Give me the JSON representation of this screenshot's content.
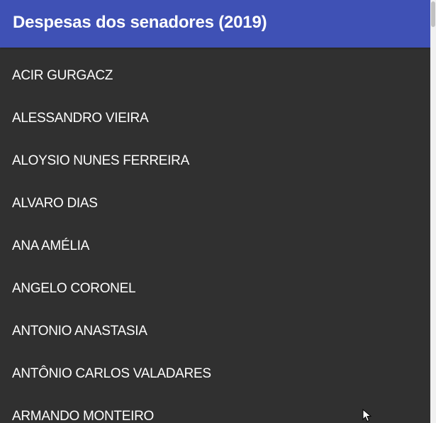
{
  "appbar": {
    "title": "Despesas dos senadores (2019)",
    "color": "#3f51b5"
  },
  "list": {
    "background": "#303030",
    "items": [
      {
        "label": "ACIR GURGACZ"
      },
      {
        "label": "ALESSANDRO VIEIRA"
      },
      {
        "label": "ALOYSIO NUNES FERREIRA"
      },
      {
        "label": "ALVARO DIAS"
      },
      {
        "label": "ANA AMÉLIA"
      },
      {
        "label": "ANGELO CORONEL"
      },
      {
        "label": "ANTONIO ANASTASIA"
      },
      {
        "label": "ANTÔNIO CARLOS VALADARES"
      },
      {
        "label": "ARMANDO MONTEIRO"
      }
    ]
  },
  "icons": {
    "cursor": "mouse-pointer-icon"
  }
}
